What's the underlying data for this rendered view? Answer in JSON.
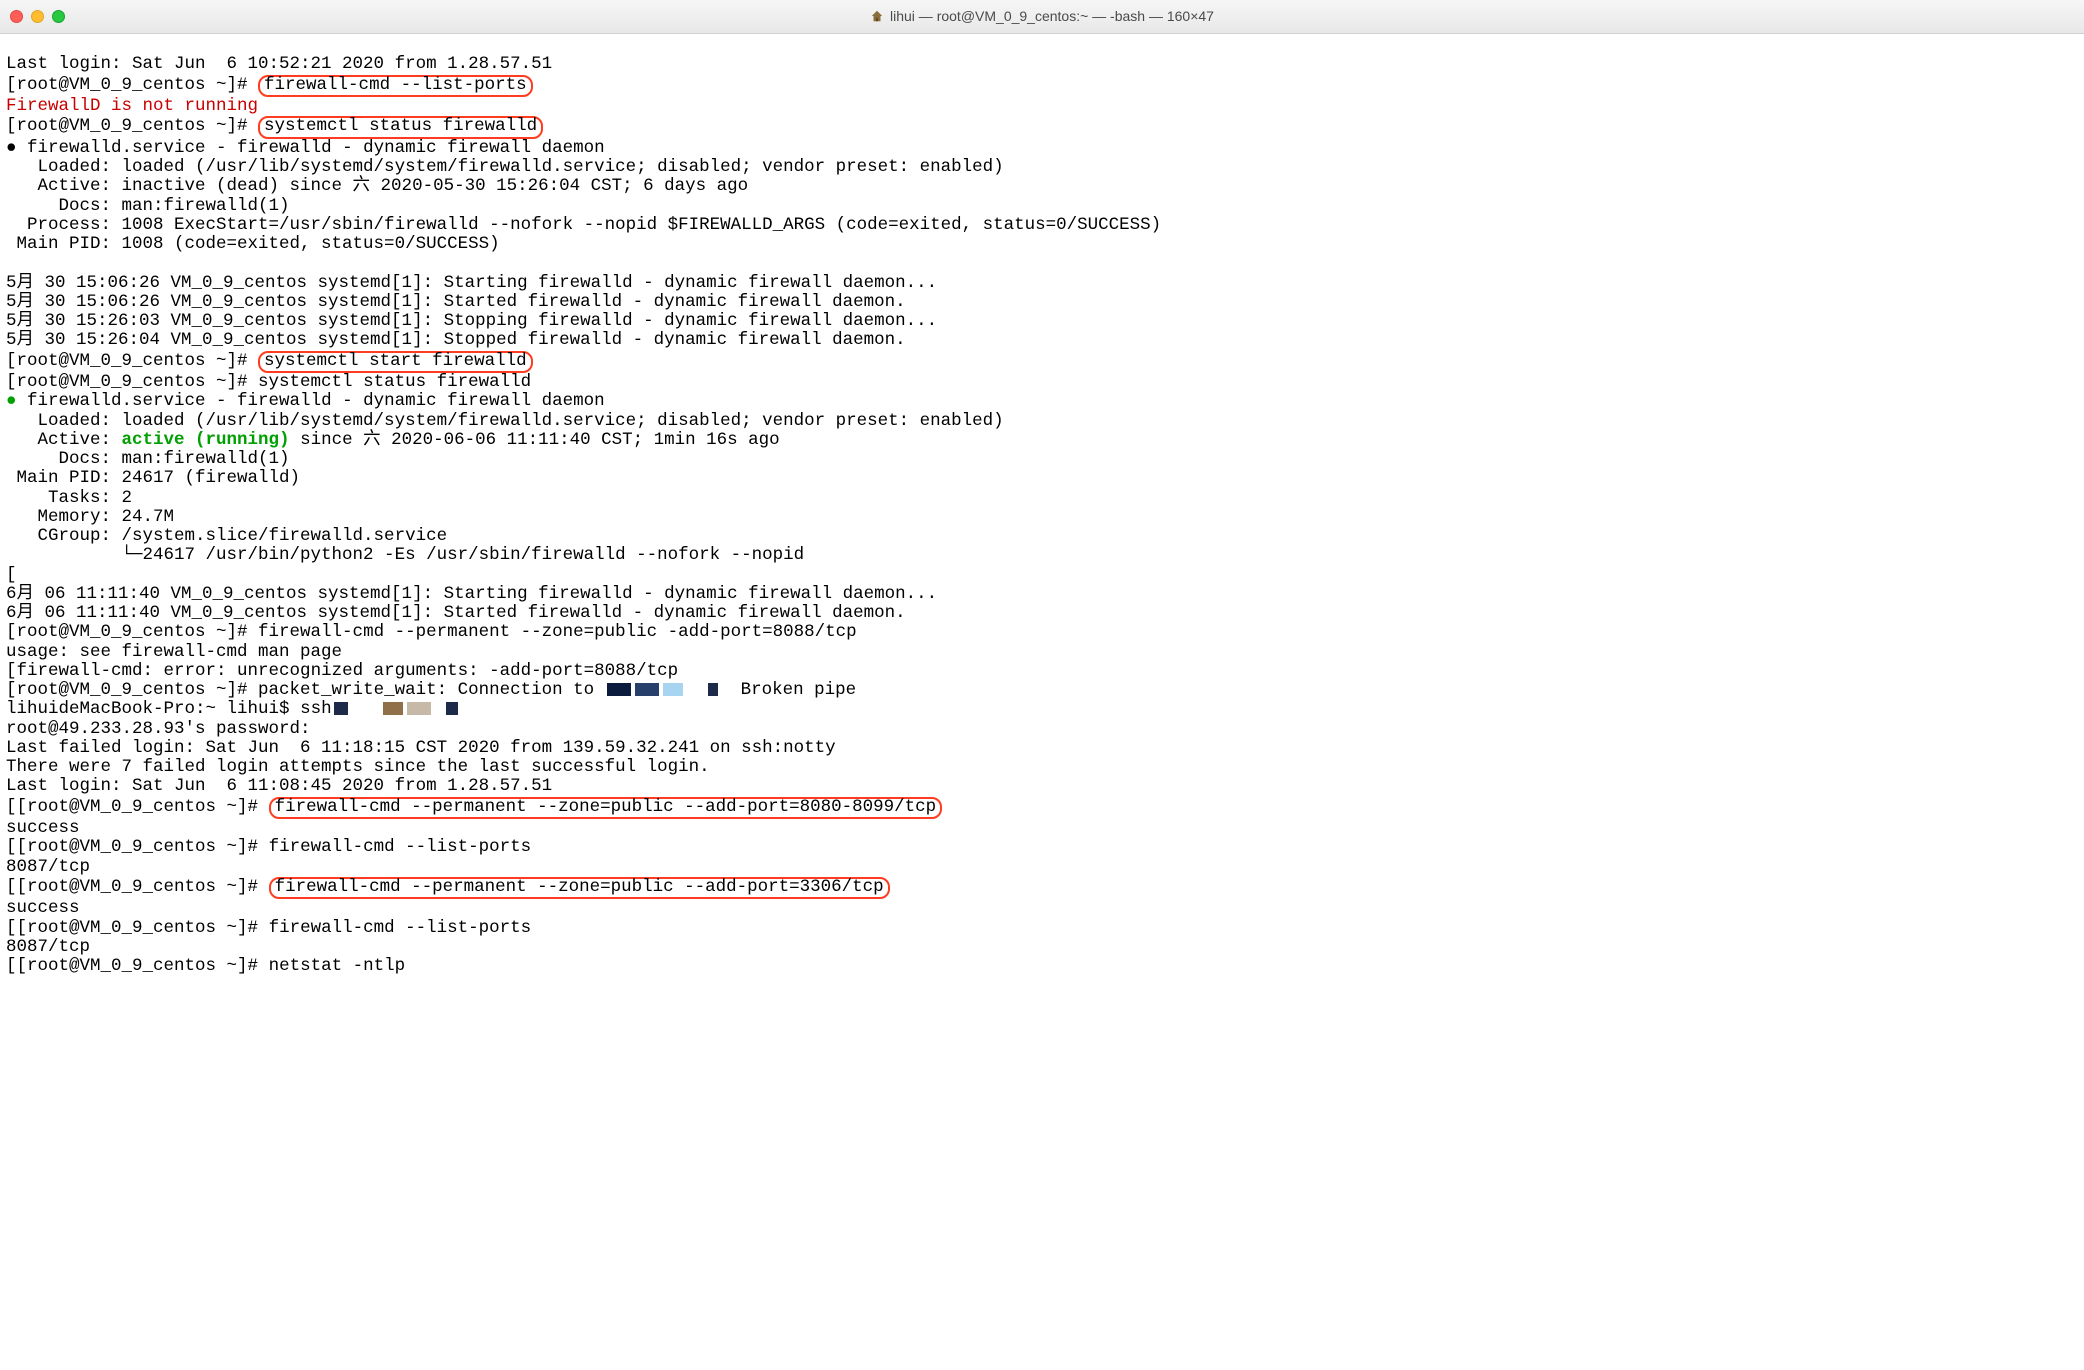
{
  "window": {
    "title": "lihui — root@VM_0_9_centos:~ — -bash — 160×47"
  },
  "prompt": "[root@VM_0_9_centos ~]# ",
  "lines": {
    "last_login1": "Last login: Sat Jun  6 10:52:21 2020 from 1.28.57.51",
    "cmd_list_ports": "firewall-cmd --list-ports",
    "firewalld_not_running": "FirewallD is not running",
    "cmd_status1": "systemctl status firewalld",
    "svc_title": " firewalld.service - firewalld - dynamic firewall daemon",
    "loaded": "   Loaded: loaded (/usr/lib/systemd/system/firewalld.service; disabled; vendor preset: enabled)",
    "active_dead": "   Active: inactive (dead) since 六 2020-05-30 15:26:04 CST; 6 days ago",
    "docs": "     Docs: man:firewalld(1)",
    "process": "  Process: 1008 ExecStart=/usr/sbin/firewalld --nofork --nopid $FIREWALLD_ARGS (code=exited, status=0/SUCCESS)",
    "main_pid": " Main PID: 1008 (code=exited, status=0/SUCCESS)",
    "log1": "5月 30 15:06:26 VM_0_9_centos systemd[1]: Starting firewalld - dynamic firewall daemon...",
    "log2": "5月 30 15:06:26 VM_0_9_centos systemd[1]: Started firewalld - dynamic firewall daemon.",
    "log3": "5月 30 15:26:03 VM_0_9_centos systemd[1]: Stopping firewalld - dynamic firewall daemon...",
    "log4": "5月 30 15:26:04 VM_0_9_centos systemd[1]: Stopped firewalld - dynamic firewall daemon.",
    "cmd_start": "systemctl start firewalld",
    "cmd_status2": "systemctl status firewalld",
    "active_running_pre": "   Active: ",
    "active_running_green": "active (running)",
    "active_running_post": " since 六 2020-06-06 11:11:40 CST; 1min 16s ago",
    "main_pid2": " Main PID: 24617 (firewalld)",
    "tasks": "    Tasks: 2",
    "memory": "   Memory: 24.7M",
    "cgroup": "   CGroup: /system.slice/firewalld.service",
    "cgroup_child": "           └─24617 /usr/bin/python2 -Es /usr/sbin/firewalld --nofork --nopid",
    "bracket_open": "[",
    "log5": "6月 06 11:11:40 VM_0_9_centos systemd[1]: Starting firewalld - dynamic firewall daemon...",
    "log6": "6月 06 11:11:40 VM_0_9_centos systemd[1]: Started firewalld - dynamic firewall daemon.",
    "cmd_addport_bad": "firewall-cmd --permanent --zone=public -add-port=8088/tcp",
    "usage": "usage: see firewall-cmd man page",
    "error_unrec": "firewall-cmd: error: unrecognized arguments: -add-port=8088/tcp",
    "packet_write_pre": "packet_write_wait: Connection to ",
    "packet_write_post": " Broken pipe",
    "local_prompt": "lihuideMacBook-Pro:~ lihui$ ",
    "ssh_cmd": "ssh",
    "ssh_extra": "   ",
    "pwd_prompt": "root@49.233.28.93's password: ",
    "last_failed": "Last failed login: Sat Jun  6 11:18:15 CST 2020 from 139.59.32.241 on ssh:notty",
    "failed_attempts": "There were 7 failed login attempts since the last successful login.",
    "last_login2": "Last login: Sat Jun  6 11:08:45 2020 from 1.28.57.51",
    "cmd_addport_range": "firewall-cmd --permanent --zone=public --add-port=8080-8099/tcp",
    "success": "success",
    "cmd_list_ports2": "firewall-cmd --list-ports",
    "out_8087": "8087/tcp",
    "cmd_addport_3306": "firewall-cmd --permanent --zone=public --add-port=3306/tcp",
    "cmd_netstat": "netstat -ntlp"
  }
}
